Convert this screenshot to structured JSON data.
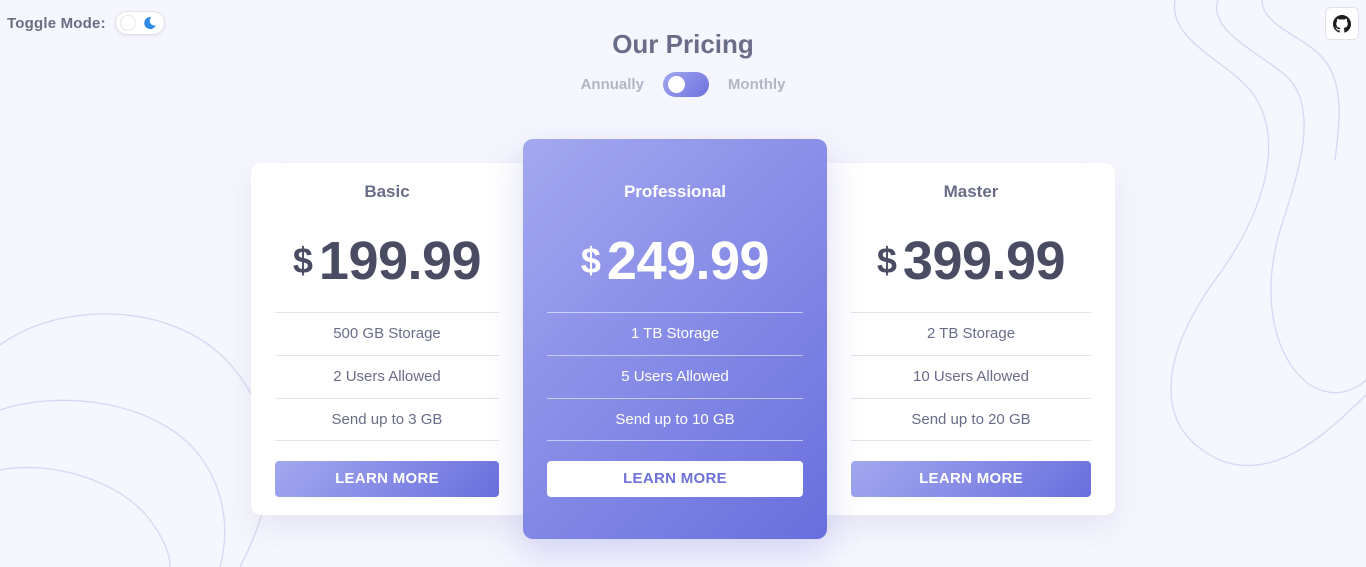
{
  "mode_toggle": {
    "label": "Toggle Mode:",
    "icon": "moon-icon",
    "icon_color": "#2f8be3"
  },
  "github": {
    "icon": "github-icon"
  },
  "header": {
    "title": "Our Pricing",
    "billing": {
      "left_label": "Annually",
      "right_label": "Monthly",
      "selected": "Annually"
    }
  },
  "colors": {
    "background": "#f6f6fe",
    "accent_start": "#a3a8f0",
    "accent_end": "#696fdd",
    "text_dark": "#4a4c64",
    "text_muted": "#6a6d88"
  },
  "plans": [
    {
      "name": "Basic",
      "currency": "$",
      "price": "199.99",
      "features": [
        "500 GB Storage",
        "2 Users Allowed",
        "Send up to 3 GB"
      ],
      "button": "LEARN MORE"
    },
    {
      "name": "Professional",
      "currency": "$",
      "price": "249.99",
      "features": [
        "1 TB Storage",
        "5 Users Allowed",
        "Send up to 10 GB"
      ],
      "button": "LEARN MORE",
      "highlighted": true
    },
    {
      "name": "Master",
      "currency": "$",
      "price": "399.99",
      "features": [
        "2 TB Storage",
        "10 Users Allowed",
        "Send up to 20 GB"
      ],
      "button": "LEARN MORE"
    }
  ]
}
